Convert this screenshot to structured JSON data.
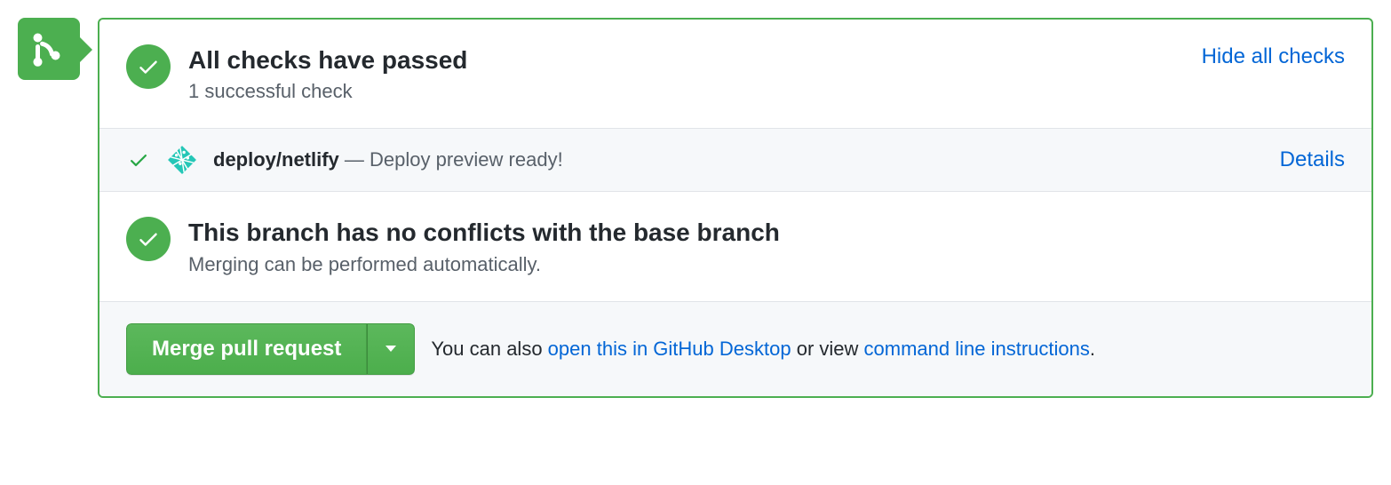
{
  "checks": {
    "title": "All checks have passed",
    "subtitle": "1 successful check",
    "hideLink": "Hide all checks",
    "items": [
      {
        "name": "deploy/netlify",
        "separator": " — ",
        "description": "Deploy preview ready!",
        "detailsLink": "Details"
      }
    ]
  },
  "merge": {
    "title": "This branch has no conflicts with the base branch",
    "subtitle": "Merging can be performed automatically."
  },
  "footer": {
    "mergeButton": "Merge pull request",
    "prefix": "You can also ",
    "desktopLink": "open this in GitHub Desktop",
    "middle": " or view ",
    "cliLink": "command line instructions",
    "suffix": "."
  }
}
